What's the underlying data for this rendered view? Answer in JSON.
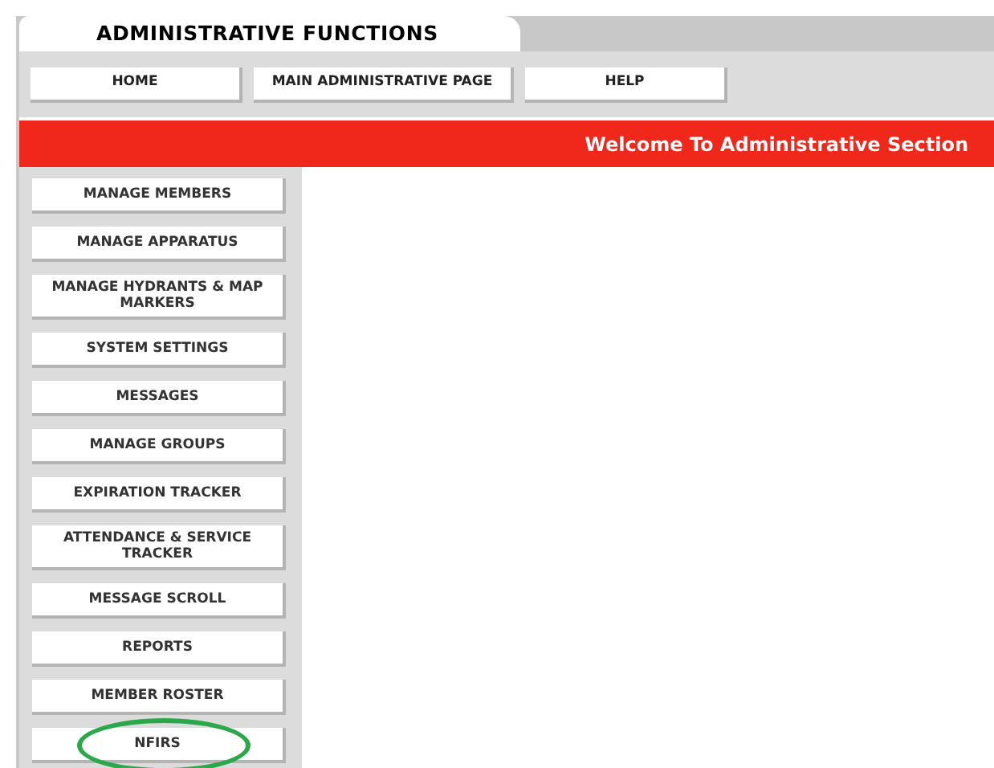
{
  "tab": {
    "title": "ADMINISTRATIVE FUNCTIONS"
  },
  "nav_buttons": [
    "HOME",
    "MAIN ADMINISTRATIVE PAGE",
    "HELP"
  ],
  "banner": {
    "text": "Welcome To Administrative Section"
  },
  "sidebar": {
    "items": [
      {
        "label": "MANAGE MEMBERS",
        "circled": false
      },
      {
        "label": "MANAGE APPARATUS",
        "circled": false
      },
      {
        "label": "MANAGE HYDRANTS & MAP MARKERS",
        "circled": false
      },
      {
        "label": "SYSTEM SETTINGS",
        "circled": false
      },
      {
        "label": "MESSAGES",
        "circled": false
      },
      {
        "label": "MANAGE GROUPS",
        "circled": false
      },
      {
        "label": "EXPIRATION TRACKER",
        "circled": false
      },
      {
        "label": "ATTENDANCE & SERVICE TRACKER",
        "circled": false
      },
      {
        "label": "MESSAGE SCROLL",
        "circled": false
      },
      {
        "label": "REPORTS",
        "circled": false
      },
      {
        "label": "MEMBER ROSTER",
        "circled": false
      },
      {
        "label": "NFIRS",
        "circled": true
      }
    ]
  }
}
